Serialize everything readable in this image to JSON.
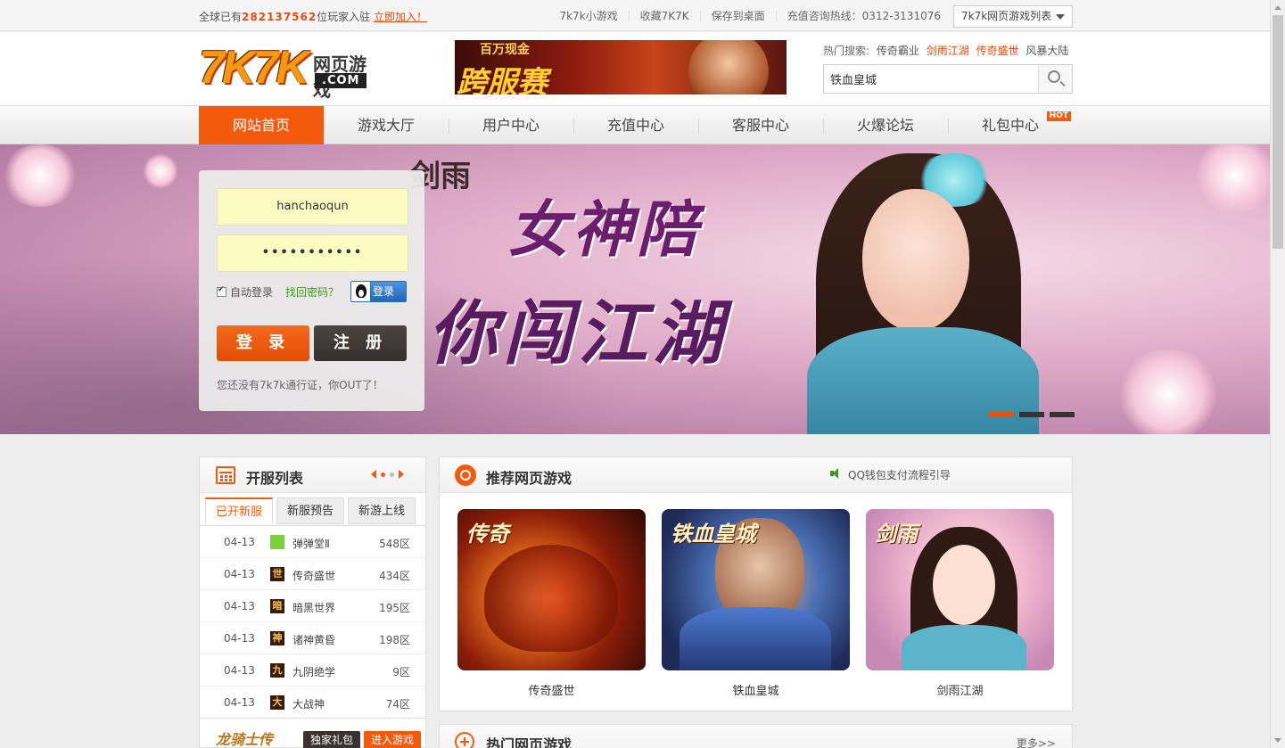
{
  "topbar": {
    "prefix": "全球已有",
    "player_count": "282137562",
    "suffix": "位玩家入驻",
    "join_link": "立即加入！",
    "links": [
      "7k7k小游戏",
      "收藏7K7K",
      "保存到桌面",
      "充值咨询热线：0312-3131076"
    ],
    "game_list_select": "7k7k网页游戏列表"
  },
  "header": {
    "logo_main": "7K7K",
    "logo_sub": "网页游戏",
    "logo_domain": ".COM",
    "ad_line1": "百万现金",
    "ad_line2": "跨服赛",
    "hot_search_label": "热门搜索:",
    "hot_search_items": [
      {
        "text": "传奇霸业",
        "color": "#555555"
      },
      {
        "text": "剑雨江湖",
        "color": "#e84c0e"
      },
      {
        "text": "传奇盛世",
        "color": "#e84c0e"
      },
      {
        "text": "风暴大陆",
        "color": "#555555"
      }
    ],
    "search_value": "铁血皇城"
  },
  "nav": {
    "items": [
      "网站首页",
      "游戏大厅",
      "用户中心",
      "充值中心",
      "客服中心",
      "火爆论坛",
      "礼包中心"
    ],
    "active_index": 0,
    "hot_badge": "HOT"
  },
  "hero": {
    "game_logo": "剑雨",
    "slogan_line1": "女神陪",
    "slogan_line2": "你闯江湖",
    "slide_count": 3,
    "active_slide": 0
  },
  "login": {
    "username": "hanchaoqun",
    "password_mask": "•••••••••••",
    "auto_login_label": "自动登录",
    "auto_login_checked": true,
    "forgot_label": "找回密码？",
    "qq_login_label": "登录",
    "login_button": "登 录",
    "register_button": "注 册",
    "tip": "您还没有7k7k通行证，你OUT了！"
  },
  "servers": {
    "title": "开服列表",
    "tabs": [
      "已开新服",
      "新服预告",
      "新游上线"
    ],
    "active_tab": 0,
    "rows": [
      {
        "date": "04-13",
        "icon": "",
        "icon_style": "green",
        "name": "弹弹堂Ⅱ",
        "zone": "548区"
      },
      {
        "date": "04-13",
        "icon": "世",
        "icon_style": "dark",
        "name": "传奇盛世",
        "zone": "434区"
      },
      {
        "date": "04-13",
        "icon": "暗",
        "icon_style": "dark",
        "name": "暗黑世界",
        "zone": "195区"
      },
      {
        "date": "04-13",
        "icon": "神",
        "icon_style": "dark",
        "name": "诸神黄昏",
        "zone": "198区"
      },
      {
        "date": "04-13",
        "icon": "九",
        "icon_style": "dark",
        "name": "九阴绝学",
        "zone": "9区"
      },
      {
        "date": "04-13",
        "icon": "大",
        "icon_style": "dark",
        "name": "大战神",
        "zone": "74区"
      }
    ],
    "promo_name": "龙骑士传",
    "promo_gift": "独家礼包",
    "promo_enter": "进入游戏"
  },
  "recommend": {
    "title": "推荐网页游戏",
    "notice": "QQ钱包支付流程引导",
    "games": [
      {
        "name": "传奇盛世",
        "tag": "传奇"
      },
      {
        "name": "铁血皇城",
        "tag": "铁血皇城"
      },
      {
        "name": "剑雨江湖",
        "tag": "剑雨"
      }
    ]
  },
  "hot": {
    "title": "热门网页游戏",
    "more": "更多>>"
  }
}
